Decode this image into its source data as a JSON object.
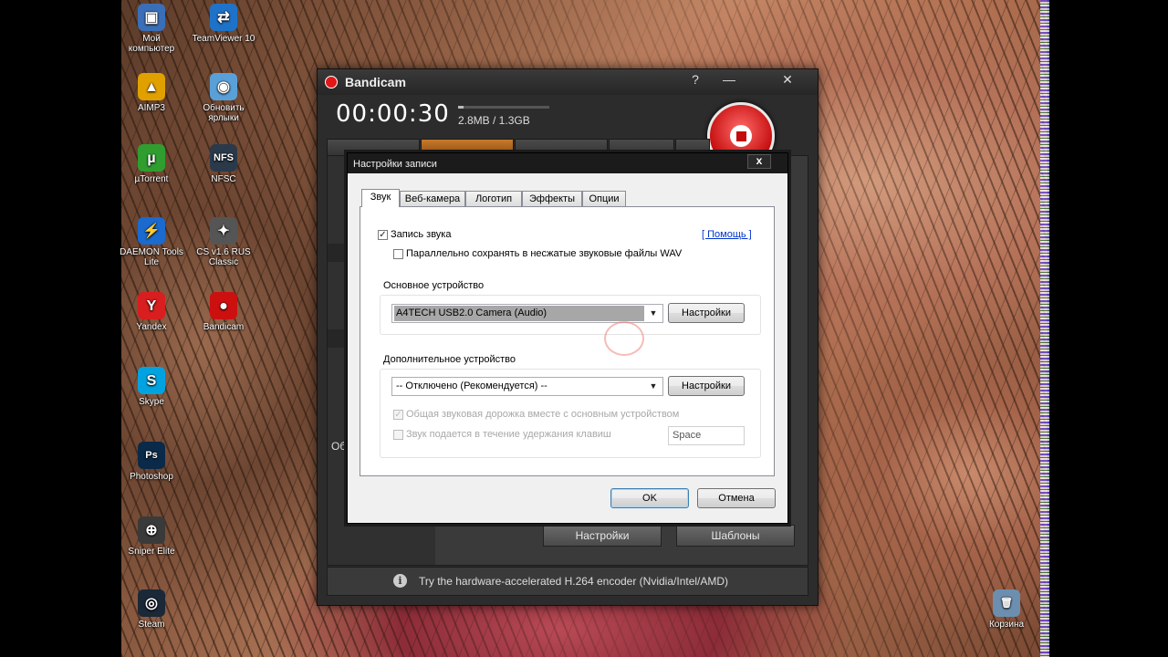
{
  "desktop": {
    "icons": [
      {
        "label": "Мой компьютер",
        "glyph": "▣",
        "color": "#3a6fb8",
        "icon": "computer-icon"
      },
      {
        "label": "TeamViewer 10",
        "glyph": "⇄",
        "color": "#1e73c8",
        "icon": "teamviewer-icon"
      },
      {
        "label": "AIMP3",
        "glyph": "▲",
        "color": "#e0a000",
        "icon": "aimp-icon"
      },
      {
        "label": "Обновить ярлыки",
        "glyph": "◉",
        "color": "#5aa0d8",
        "icon": "update-shortcuts-icon"
      },
      {
        "label": "µTorrent",
        "glyph": "µ",
        "color": "#2f9e2f",
        "icon": "utorrent-icon"
      },
      {
        "label": "NFSC",
        "glyph": "NFS",
        "color": "#2a3a4a",
        "icon": "nfsc-icon"
      },
      {
        "label": "DAEMON Tools Lite",
        "glyph": "⚡",
        "color": "#1a6ad0",
        "icon": "daemon-tools-icon"
      },
      {
        "label": "CS v1.6 RUS Classic",
        "glyph": "✦",
        "color": "#555555",
        "icon": "counter-strike-icon"
      },
      {
        "label": "Yandex",
        "glyph": "Y",
        "color": "#d81e1e",
        "icon": "yandex-icon"
      },
      {
        "label": "Bandicam",
        "glyph": "●",
        "color": "#cc1010",
        "icon": "bandicam-desktop-icon"
      },
      {
        "label": "Skype",
        "glyph": "S",
        "color": "#00a3e0",
        "icon": "skype-icon"
      },
      {
        "label": "Photoshop",
        "glyph": "Ps",
        "color": "#0b2a4a",
        "icon": "photoshop-icon"
      },
      {
        "label": "Sniper Elite",
        "glyph": "⊕",
        "color": "#3a3a3a",
        "icon": "sniper-elite-icon"
      },
      {
        "label": "Steam",
        "glyph": "◎",
        "color": "#1b2838",
        "icon": "steam-icon"
      },
      {
        "label": "Корзина",
        "glyph": "🗑",
        "color": "#6c8fb0",
        "icon": "recycle-bin-icon"
      }
    ]
  },
  "bandicam": {
    "title": "Bandicam",
    "help_label": "?",
    "minimize_label": "—",
    "close_label": "✕",
    "timer": "00:00:30",
    "size": "2.8MB / 1.3GB",
    "size_fraction": 0.06,
    "side_label": "Об",
    "settings_button": "Настройки",
    "templates_button": "Шаблоны",
    "tip_text": "Try the hardware-accelerated H.264 encoder (Nvidia/Intel/AMD)",
    "tip_icon": "i"
  },
  "dialog": {
    "title": "Настройки записи",
    "close_label": "x",
    "tabs": [
      "Звук",
      "Веб-камера",
      "Логотип",
      "Эффекты",
      "Опции"
    ],
    "active_tab": 0,
    "record_sound": "Запись звука",
    "record_sound_checked": true,
    "save_wav": "Параллельно сохранять в несжатые звуковые файлы WAV",
    "save_wav_checked": false,
    "help_link": "[ Помощь ]",
    "primary_label": "Основное устройство",
    "primary_device": "A4TECH USB2.0 Camera (Audio)",
    "settings_label": "Настройки",
    "secondary_label": "Дополнительное устройство",
    "secondary_device": "-- Отключено (Рекомендуется) --",
    "common_track": "Общая звуковая дорожка вместе с основным устройством",
    "common_track_checked": true,
    "hold_key": "Звук подается в течение удержания клавиш",
    "hold_key_checked": false,
    "hotkey_value": "Space",
    "ok_label": "OK",
    "cancel_label": "Отмена"
  }
}
